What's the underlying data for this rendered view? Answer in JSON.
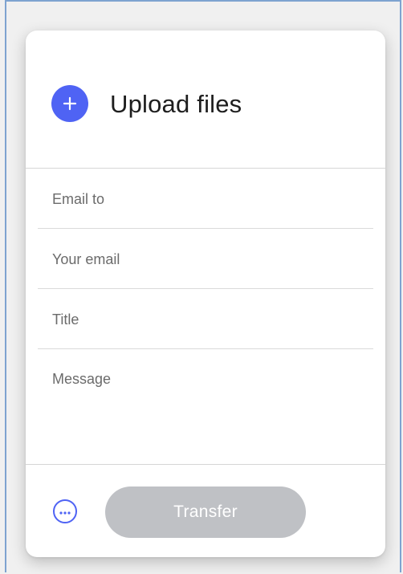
{
  "upload": {
    "title": "Upload files",
    "add_icon": "plus-icon",
    "accent_color": "#4f63f4"
  },
  "form": {
    "email_to_placeholder": "Email to",
    "your_email_placeholder": "Your email",
    "title_placeholder": "Title",
    "message_placeholder": "Message"
  },
  "footer": {
    "more_icon": "more-options-icon",
    "transfer_label": "Transfer",
    "transfer_color": "#bfc1c5"
  }
}
